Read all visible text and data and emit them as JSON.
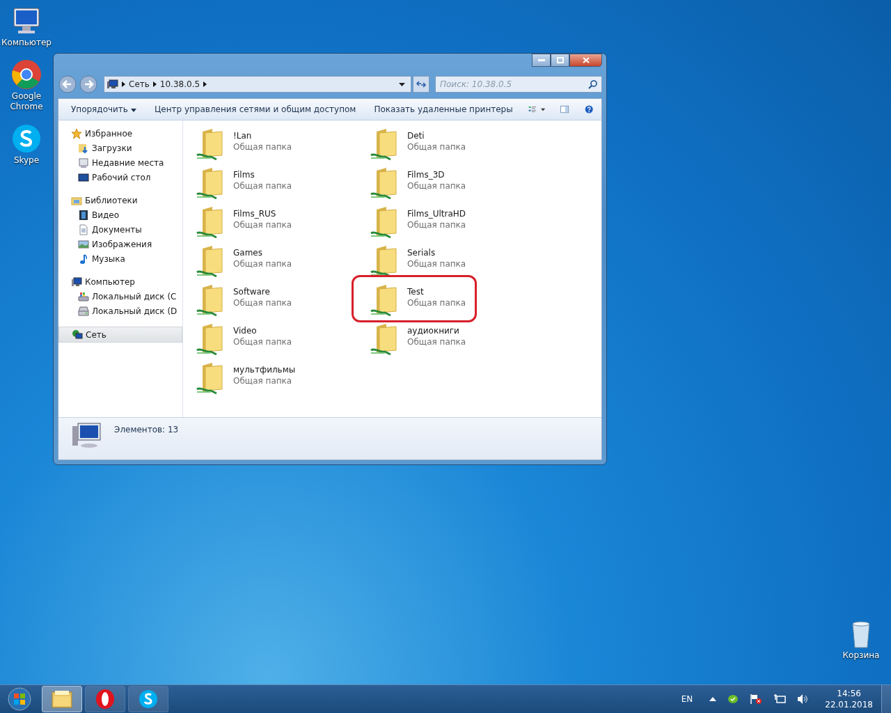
{
  "desktop_icons": [
    {
      "label": "Компьютер",
      "kind": "computer"
    },
    {
      "label": "Google Chrome",
      "kind": "chrome"
    },
    {
      "label": "Skype",
      "kind": "skype"
    },
    {
      "label": "Корзина",
      "kind": "bin"
    }
  ],
  "window": {
    "breadcrumb": [
      "Сеть",
      "10.38.0.5"
    ],
    "search": {
      "placeholder": "Поиск: 10.38.0.5"
    },
    "toolbar": [
      {
        "label": "Упорядочить",
        "dropdown": true
      },
      {
        "label": "Центр управления сетями и общим доступом",
        "dropdown": false
      },
      {
        "label": "Показать удаленные принтеры",
        "dropdown": false
      }
    ],
    "sidebar": [
      {
        "label": "Избранное",
        "kind": "star",
        "selected": false,
        "children": [
          {
            "label": "Загрузки",
            "kind": "downloads"
          },
          {
            "label": "Недавние места",
            "kind": "recent"
          },
          {
            "label": "Рабочий стол",
            "kind": "desktop"
          }
        ]
      },
      {
        "label": "Библиотеки",
        "kind": "library",
        "selected": false,
        "children": [
          {
            "label": "Видео",
            "kind": "video"
          },
          {
            "label": "Документы",
            "kind": "document"
          },
          {
            "label": "Изображения",
            "kind": "picture"
          },
          {
            "label": "Музыка",
            "kind": "music"
          }
        ]
      },
      {
        "label": "Компьютер",
        "kind": "computer",
        "selected": false,
        "children": [
          {
            "label": "Локальный диск (C",
            "kind": "sysdisk"
          },
          {
            "label": "Локальный диск (D",
            "kind": "disk"
          }
        ]
      },
      {
        "label": "Сеть",
        "kind": "network",
        "selected": true
      }
    ],
    "folders": [
      {
        "name": "!Lan",
        "type": "Общая папка",
        "highlighted": false
      },
      {
        "name": "Deti",
        "type": "Общая папка",
        "highlighted": false
      },
      {
        "name": "Films",
        "type": "Общая папка",
        "highlighted": false
      },
      {
        "name": "Films_3D",
        "type": "Общая папка",
        "highlighted": false
      },
      {
        "name": "Films_RUS",
        "type": "Общая папка",
        "highlighted": false
      },
      {
        "name": "Films_UltraHD",
        "type": "Общая папка",
        "highlighted": false
      },
      {
        "name": "Games",
        "type": "Общая папка",
        "highlighted": false
      },
      {
        "name": "Serials",
        "type": "Общая папка",
        "highlighted": false
      },
      {
        "name": "Software",
        "type": "Общая папка",
        "highlighted": false
      },
      {
        "name": "Test",
        "type": "Общая папка",
        "highlighted": true
      },
      {
        "name": "Video",
        "type": "Общая папка",
        "highlighted": false
      },
      {
        "name": "аудиокниги",
        "type": "Общая папка",
        "highlighted": false
      },
      {
        "name": "мультфильмы",
        "type": "Общая папка",
        "highlighted": false
      }
    ],
    "status": "Элементов: 13"
  },
  "taskbar": {
    "apps": [
      {
        "kind": "explorer",
        "active": true
      },
      {
        "kind": "opera",
        "active": false
      },
      {
        "kind": "skype",
        "active": false
      }
    ],
    "language": "EN",
    "time": "14:56",
    "date": "22.01.2018"
  }
}
